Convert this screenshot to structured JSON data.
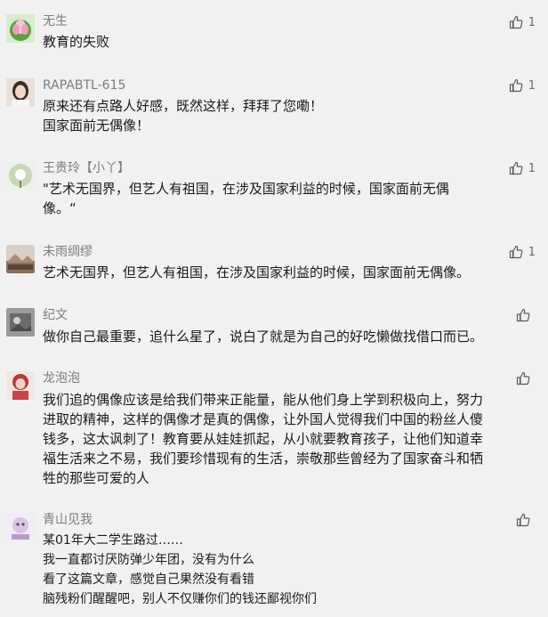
{
  "comments": [
    {
      "name": "无生",
      "lines": [
        "教育的失败"
      ],
      "likes": "1",
      "avatar_color": "#5aa33b"
    },
    {
      "name": "RAPABTL-615",
      "lines": [
        "原来还有点路人好感，既然这样，拜拜了您嘞！",
        "国家面前无偶像！"
      ],
      "likes": "1",
      "avatar_color": "#b9a39a"
    },
    {
      "name": "王贵玲【小丫】",
      "lines": [
        "\"艺术无国界，但艺人有祖国，在涉及国家利益的时候，国家面前无偶",
        "像。“"
      ],
      "likes": "1",
      "avatar_color": "#8aa46c"
    },
    {
      "name": "未雨绸缪",
      "lines": [
        "艺术无国界，但艺人有祖国，在涉及国家利益的时候，国家面前无偶像。"
      ],
      "likes": "1",
      "avatar_color": "#8c6e5c"
    },
    {
      "name": "纪文",
      "lines": [
        "做你自己最重要，追什么星了，说白了就是为自己的好吃懒做找借口而已。"
      ],
      "likes": "",
      "avatar_color": "#6a6a6a"
    },
    {
      "name": "龙泡泡",
      "lines": [
        "我们追的偶像应该是给我们带来正能量，能从他们身上学到积极向上，努力",
        "进取的精神，这样的偶像才是真的偶像，让外国人觉得我们中国的粉丝人傻",
        "钱多，这太讽刺了！教育要从娃娃抓起，从小就要教育孩子，让他们知道幸",
        "福生活来之不易，我们要珍惜现有的生活，崇敬那些曾经为了国家奋斗和牺",
        "牲的那些可爱的人"
      ],
      "likes": "",
      "avatar_color": "#b53a3a"
    },
    {
      "name": "青山见我",
      "lines": [
        "某01年大二学生路过……",
        "我一直都讨厌防弹少年团，没有为什么",
        "看了这篇文章，感觉自己果然没有看错",
        "脑残粉们醒醒吧，别人不仅赚你们的钱还鄙视你们"
      ],
      "likes": "",
      "avatar_color": "#b79acb"
    }
  ]
}
